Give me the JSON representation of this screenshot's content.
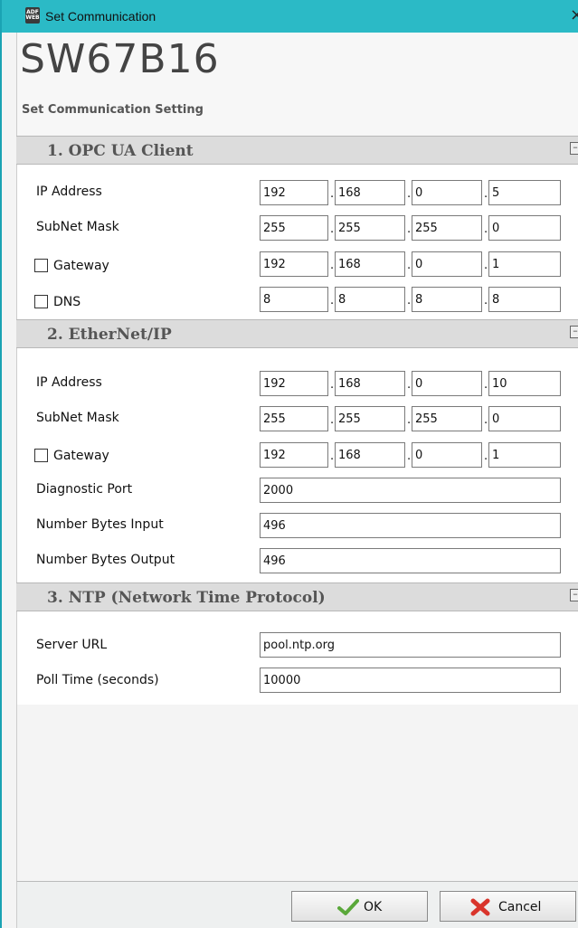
{
  "window": {
    "title": "Set Communication",
    "icon": "app-logo-icon",
    "close": "×"
  },
  "header": {
    "device": "SW67B16",
    "subtitle": "Set Communication Setting"
  },
  "sections": [
    {
      "title": "1. OPC UA Client",
      "collapse": "–"
    },
    {
      "title": "2. EtherNet/IP",
      "collapse": "–"
    },
    {
      "title": "3. NTP (Network Time Protocol)",
      "collapse": "–"
    }
  ],
  "opc": {
    "ip": {
      "label": "IP Address",
      "octets": [
        "192",
        "168",
        "0",
        "5"
      ]
    },
    "mask": {
      "label": "SubNet Mask",
      "octets": [
        "255",
        "255",
        "255",
        "0"
      ]
    },
    "gateway": {
      "label": "Gateway",
      "checked": false,
      "octets": [
        "192",
        "168",
        "0",
        "1"
      ]
    },
    "dns": {
      "label": "DNS",
      "checked": false,
      "octets": [
        "8",
        "8",
        "8",
        "8"
      ]
    }
  },
  "eip": {
    "ip": {
      "label": "IP Address",
      "octets": [
        "192",
        "168",
        "0",
        "10"
      ]
    },
    "mask": {
      "label": "SubNet Mask",
      "octets": [
        "255",
        "255",
        "255",
        "0"
      ]
    },
    "gateway": {
      "label": "Gateway",
      "checked": false,
      "octets": [
        "192",
        "168",
        "0",
        "1"
      ]
    },
    "diag_port": {
      "label": "Diagnostic Port",
      "value": "2000"
    },
    "bytes_in": {
      "label": "Number Bytes Input",
      "value": "496"
    },
    "bytes_out": {
      "label": "Number Bytes Output",
      "value": "496"
    }
  },
  "ntp": {
    "server": {
      "label": "Server URL",
      "value": "pool.ntp.org"
    },
    "poll": {
      "label": "Poll Time (seconds)",
      "value": "10000"
    }
  },
  "buttons": {
    "ok": "OK",
    "cancel": "Cancel"
  },
  "colors": {
    "titlebar": "#2bbac6",
    "section_header": "#dcdcdc",
    "ok_icon": "#5aa83a",
    "cancel_icon": "#d9342b"
  }
}
